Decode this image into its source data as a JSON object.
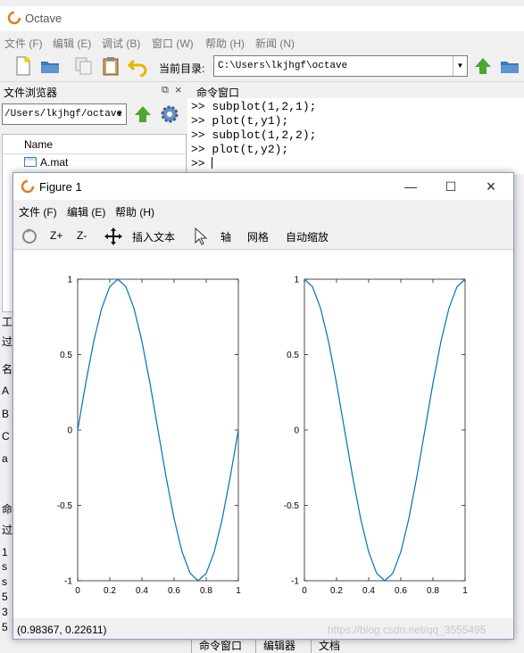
{
  "main_window": {
    "title": "Octave",
    "menu": [
      "文件 (F)",
      "编辑 (E)",
      "调试 (B)",
      "窗口 (W)",
      "帮助 (H)",
      "新闻 (N)"
    ],
    "current_dir_label": "当前目录:",
    "current_dir": "C:\\Users\\lkjhgf\\octave"
  },
  "file_browser": {
    "title": "文件浏览器",
    "path": "/Users/lkjhgf/octave",
    "column_name": "Name",
    "files": [
      "A.mat"
    ]
  },
  "command_window": {
    "title": "命令窗口",
    "lines": [
      ">> subplot(1,2,1);",
      ">> plot(t,y1);",
      ">> subplot(1,2,2);",
      ">> plot(t,y2);",
      ">> "
    ]
  },
  "left_stubs": [
    "工",
    "过",
    "名",
    "A",
    "B",
    "C",
    "a",
    "命",
    "过",
    "1",
    "s",
    "s",
    "5",
    "3",
    "5"
  ],
  "bottom_tabs": [
    "命令窗口",
    "编辑器",
    "文档"
  ],
  "figure_window": {
    "title": "Figure 1",
    "menu": [
      "文件 (F)",
      "编辑 (E)",
      "帮助 (H)"
    ],
    "toolbar": {
      "zoom_in": "Z+",
      "zoom_out": "Z-",
      "insert_text": "插入文本",
      "axis": "轴",
      "grid": "网格",
      "autoscale": "自动缩放"
    },
    "status": "(0.98367, 0.22611)",
    "watermark": "https://blog.csdn.net/qq_3555495"
  },
  "colors": {
    "line": "#0072bd",
    "plot_bg": "#ffffff"
  },
  "chart_data": [
    {
      "type": "line",
      "title": "",
      "xlabel": "",
      "ylabel": "",
      "xlim": [
        0,
        1
      ],
      "ylim": [
        -1,
        1
      ],
      "xticks": [
        "0",
        "0.2",
        "0.4",
        "0.6",
        "0.8",
        "1"
      ],
      "yticks": [
        "-1",
        "-0.5",
        "0",
        "0.5",
        "1"
      ],
      "grid": false,
      "series": [
        {
          "x": [
            0,
            0.05,
            0.1,
            0.15,
            0.2,
            0.25,
            0.3,
            0.35,
            0.4,
            0.45,
            0.5,
            0.55,
            0.6,
            0.65,
            0.7,
            0.75,
            0.8,
            0.85,
            0.9,
            0.95,
            1
          ],
          "values": [
            0,
            0.309,
            0.588,
            0.809,
            0.951,
            1,
            0.951,
            0.809,
            0.588,
            0.309,
            0,
            -0.309,
            -0.588,
            -0.809,
            -0.951,
            -1,
            -0.951,
            -0.809,
            -0.588,
            -0.309,
            0
          ]
        }
      ]
    },
    {
      "type": "line",
      "title": "",
      "xlabel": "",
      "ylabel": "",
      "xlim": [
        0,
        1
      ],
      "ylim": [
        -1,
        1
      ],
      "xticks": [
        "0",
        "0.2",
        "0.4",
        "0.6",
        "0.8",
        "1"
      ],
      "yticks": [
        "-1",
        "-0.5",
        "0",
        "0.5",
        "1"
      ],
      "grid": false,
      "series": [
        {
          "x": [
            0,
            0.05,
            0.1,
            0.15,
            0.2,
            0.25,
            0.3,
            0.35,
            0.4,
            0.45,
            0.5,
            0.55,
            0.6,
            0.65,
            0.7,
            0.75,
            0.8,
            0.85,
            0.9,
            0.95,
            1
          ],
          "values": [
            1,
            0.951,
            0.809,
            0.588,
            0.309,
            0,
            -0.309,
            -0.588,
            -0.809,
            -0.951,
            -1,
            -0.951,
            -0.809,
            -0.588,
            -0.309,
            0,
            0.309,
            0.588,
            0.809,
            0.951,
            1
          ]
        }
      ]
    }
  ]
}
